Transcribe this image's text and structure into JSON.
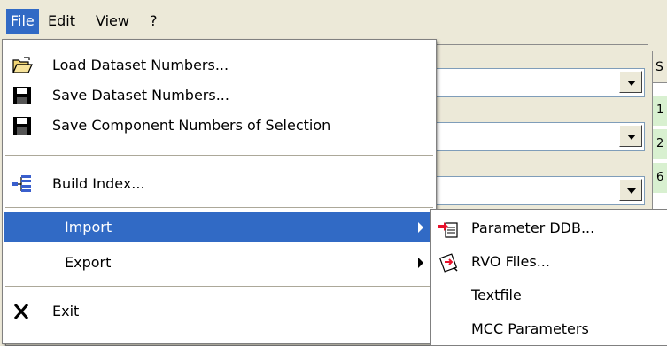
{
  "menubar": {
    "items": [
      {
        "label": "File"
      },
      {
        "label": "Edit"
      },
      {
        "label": "View"
      },
      {
        "label": "?"
      }
    ]
  },
  "file_menu": {
    "items": [
      {
        "label": "Load Dataset Numbers...",
        "icon": "open-folder-icon"
      },
      {
        "label": "Save Dataset Numbers...",
        "icon": "floppy-disk-icon"
      },
      {
        "label": "Save Component Numbers of Selection",
        "icon": "floppy-disk-icon"
      },
      {
        "label": "Build Index...",
        "icon": "tree-index-icon"
      },
      {
        "label": "Import",
        "icon": "",
        "has_submenu": true
      },
      {
        "label": "Export",
        "icon": "",
        "has_submenu": true
      },
      {
        "label": "Exit",
        "icon": "close-x-icon"
      }
    ]
  },
  "import_submenu": {
    "items": [
      {
        "label": "Parameter DDB...",
        "icon": "import-document-icon"
      },
      {
        "label": "RVO Files...",
        "icon": "rvo-files-icon"
      },
      {
        "label": "Textfile",
        "icon": ""
      },
      {
        "label": "MCC Parameters",
        "icon": ""
      }
    ]
  },
  "right_panel": {
    "header": "S",
    "cells": [
      "1",
      "2",
      "6"
    ]
  },
  "colors": {
    "highlight": "#316ac5",
    "window_bg": "#ece9d8",
    "menu_bg": "#ffffff"
  }
}
